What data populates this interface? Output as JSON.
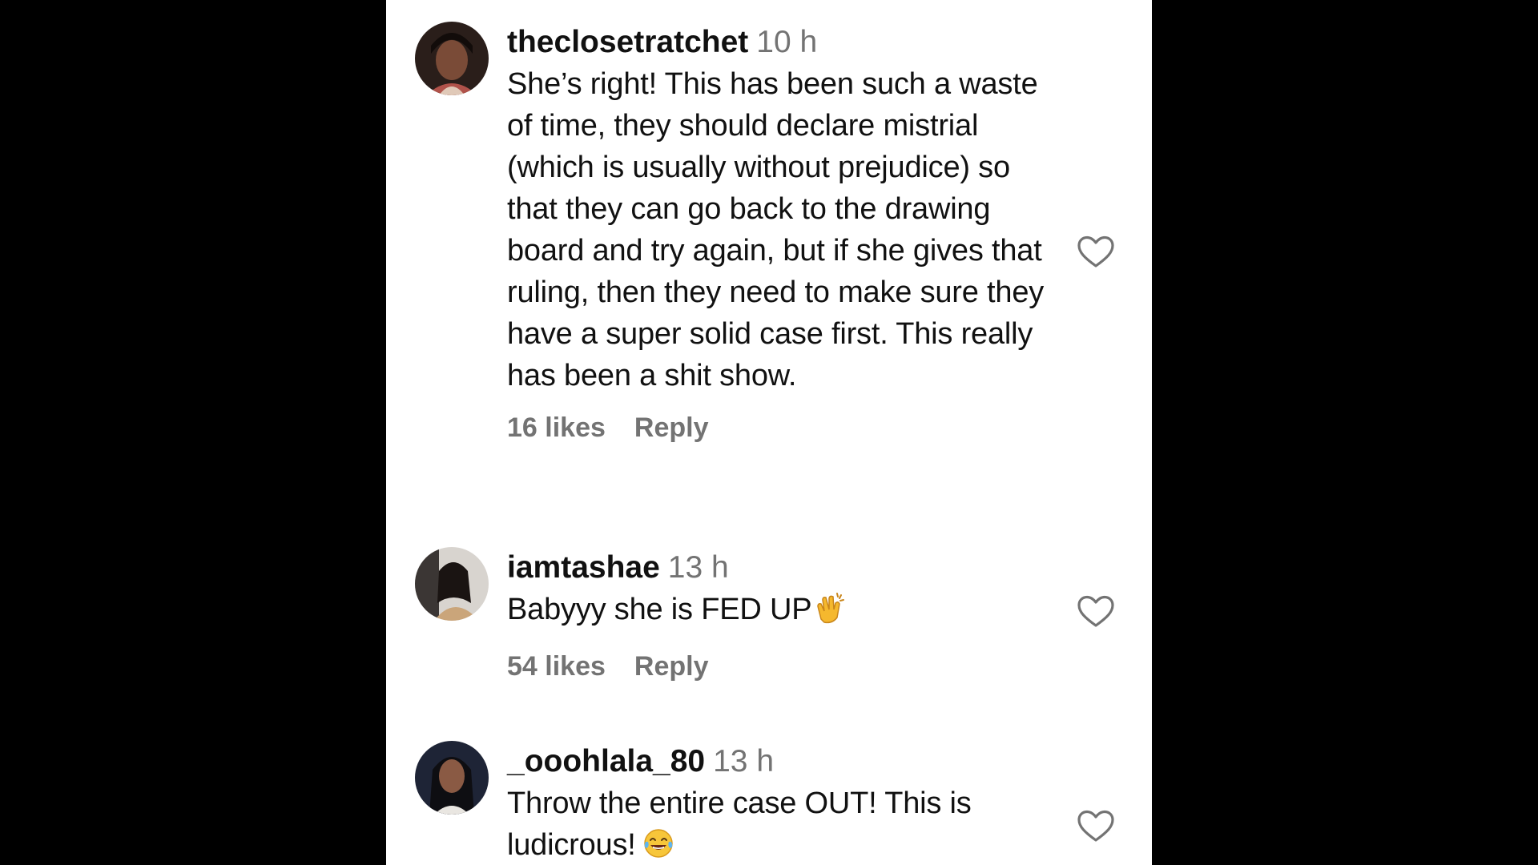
{
  "colors": {
    "background": "#000000",
    "panel": "#ffffff",
    "text": "#111111",
    "muted": "#737373",
    "heart_stroke": "#737373"
  },
  "comments": [
    {
      "username": "theclosetratchet",
      "time": "10 h",
      "text": "She’s right! This has been such a waste of time, they should declare mistrial (which is usually without prejudice) so that they can go back to the drawing board and try again, but if she gives that ruling, then they need to make sure they have a super solid case first. This really has been a shit show.",
      "likes": "16 likes",
      "reply": "Reply",
      "emoji": null,
      "like_icon": "heart-outline-icon"
    },
    {
      "username": "iamtashae",
      "time": "13 h",
      "text": "Babyyy she is FED UP",
      "likes": "54 likes",
      "reply": "Reply",
      "emoji": "clapping-hands-emoji",
      "like_icon": "heart-outline-icon"
    },
    {
      "username": "_ooohlala_80",
      "time": "13 h",
      "text": "Throw the entire case OUT! This is ludicrous!",
      "likes": "",
      "reply": "",
      "emoji": "tears-of-joy-emoji",
      "like_icon": "heart-outline-icon"
    }
  ]
}
